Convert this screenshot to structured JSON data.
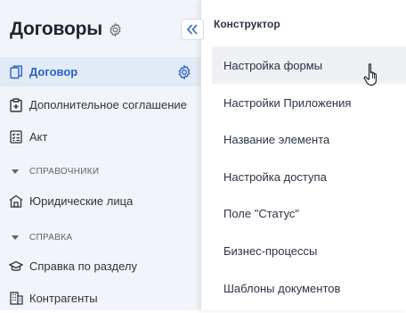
{
  "sidebar": {
    "title": "Договоры",
    "items": [
      {
        "label": "Договор",
        "icon": "document-copy-icon",
        "active": true
      },
      {
        "label": "Дополнительное соглашение",
        "icon": "clipboard-add-icon"
      },
      {
        "label": "Акт",
        "icon": "checklist-icon"
      }
    ],
    "sections": [
      {
        "label": "СПРАВОЧНИКИ",
        "items": [
          {
            "label": "Юридические лица",
            "icon": "building-icon"
          }
        ]
      },
      {
        "label": "СПРАВКА",
        "items": [
          {
            "label": "Справка по разделу",
            "icon": "graduation-cap-icon"
          },
          {
            "label": "Контрагенты",
            "icon": "office-building-icon"
          }
        ]
      }
    ]
  },
  "menu": {
    "header": "Конструктор",
    "items": [
      {
        "label": "Настройка формы",
        "hovered": true
      },
      {
        "label": "Настройки Приложения"
      },
      {
        "label": "Название элемента"
      },
      {
        "label": "Настройка доступа"
      },
      {
        "label": "Поле \"Статус\""
      },
      {
        "label": "Бизнес-процессы"
      },
      {
        "label": "Шаблоны документов"
      }
    ]
  },
  "colors": {
    "accent": "#2b62c9",
    "sidebar_bg": "#f1f5fa",
    "active_bg": "#e2eaf6",
    "hover_bg": "#eef0f3"
  }
}
